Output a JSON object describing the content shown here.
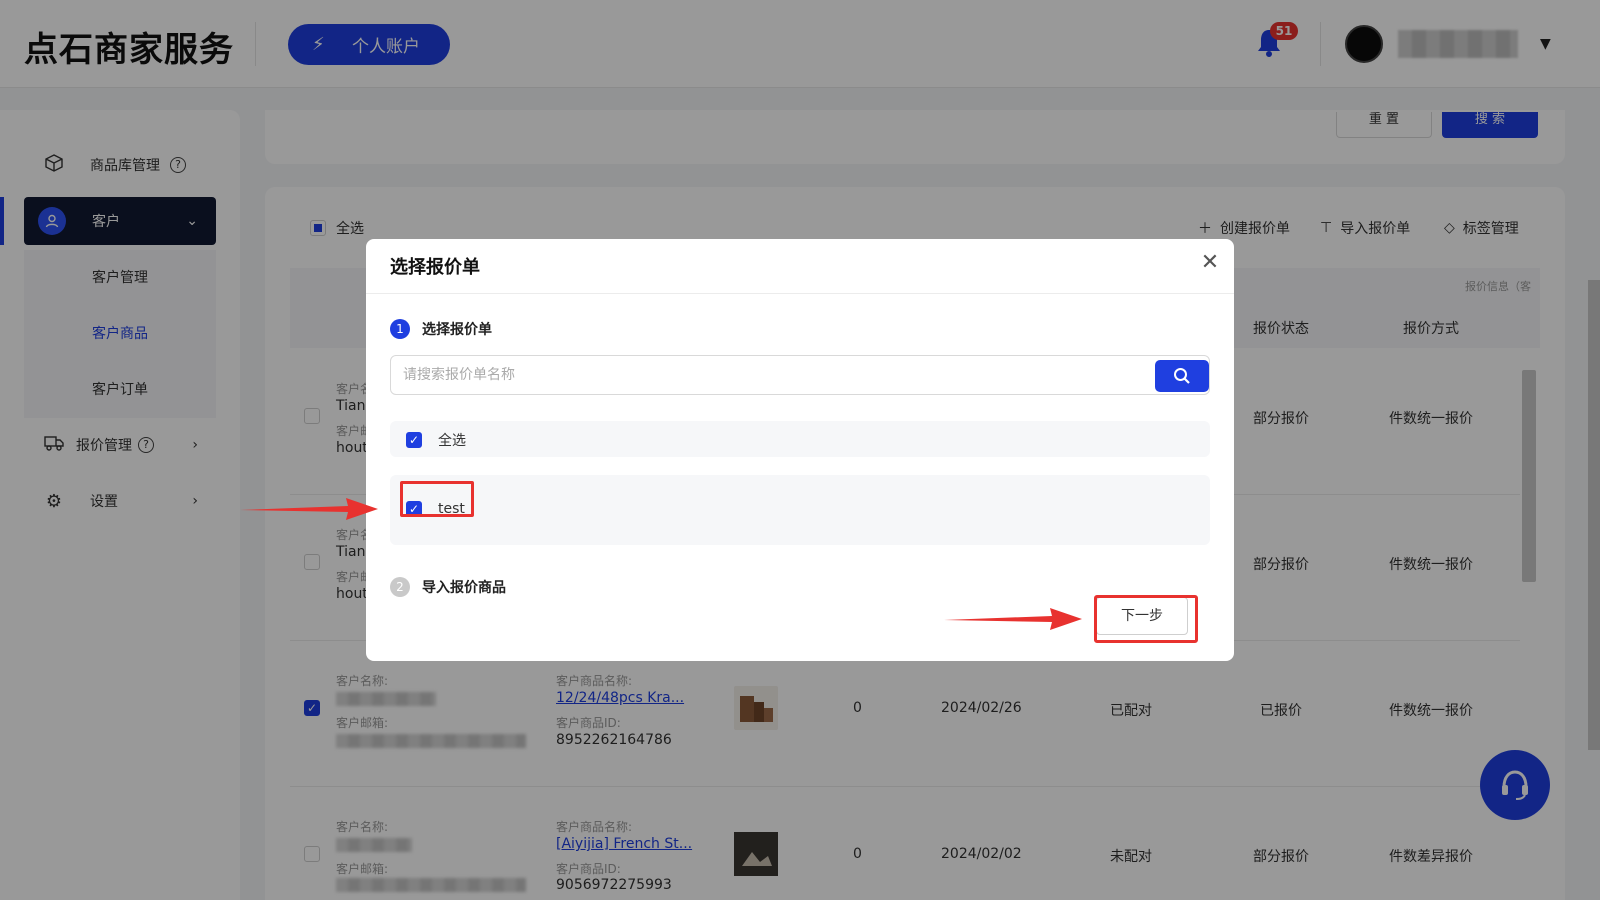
{
  "header": {
    "logo": "点石商家服务",
    "account_button": "个人账户",
    "notification_count": "51"
  },
  "sidebar": {
    "items": [
      {
        "label": "商品库管理"
      },
      {
        "label": "客户"
      },
      {
        "label": "报价管理"
      },
      {
        "label": "设置"
      }
    ],
    "sub_items": [
      {
        "label": "客户管理"
      },
      {
        "label": "客户商品"
      },
      {
        "label": "客户订单"
      }
    ]
  },
  "filter": {
    "reset_label": "重 置",
    "search_label": "搜 索"
  },
  "list": {
    "select_all": "全选",
    "actions": {
      "create": "创建报价单",
      "import": "导入报价单",
      "tags": "标签管理"
    },
    "head_info": "报价信息（客",
    "columns": {
      "quote_status": "报价状态",
      "quote_method": "报价方式"
    },
    "rows": [
      {
        "name_label": "客户名",
        "name": "Tiany",
        "email_label": "客户邮",
        "email": "hout",
        "quote_status": "部分报价",
        "quote_method": "件数统一报价"
      },
      {
        "name_label": "客户名",
        "name": "Tiany",
        "email_label": "客户邮",
        "email": "hout",
        "quote_status": "部分报价",
        "quote_method": "件数统一报价"
      },
      {
        "name_label": "客户名称:",
        "email_label": "客户邮箱:",
        "product_label": "客户商品名称:",
        "product": "12/24/48pcs Kra...",
        "id_label": "客户商品ID:",
        "product_id": "8952262164786",
        "qty": "0",
        "date": "2024/02/26",
        "match": "已配对",
        "quote_status": "已报价",
        "quote_method": "件数统一报价"
      },
      {
        "name_label": "客户名称:",
        "email_label": "客户邮箱:",
        "product_label": "客户商品名称:",
        "product": "[Aiyijia] French St...",
        "id_label": "客户商品ID:",
        "product_id": "9056972275993",
        "qty": "0",
        "date": "2024/02/02",
        "match": "未配对",
        "quote_status": "部分报价",
        "quote_method": "件数差异报价"
      }
    ]
  },
  "modal": {
    "title": "选择报价单",
    "step1": {
      "num": "1",
      "label": "选择报价单"
    },
    "step2": {
      "num": "2",
      "label": "导入报价商品"
    },
    "search_placeholder": "请搜索报价单名称",
    "select_all": "全选",
    "options": [
      {
        "label": "test"
      }
    ],
    "next_button": "下一步"
  },
  "colors": {
    "accent": "#1f3fe0",
    "annotation_red": "#e8322f",
    "sidebar_active": "#121a33"
  }
}
